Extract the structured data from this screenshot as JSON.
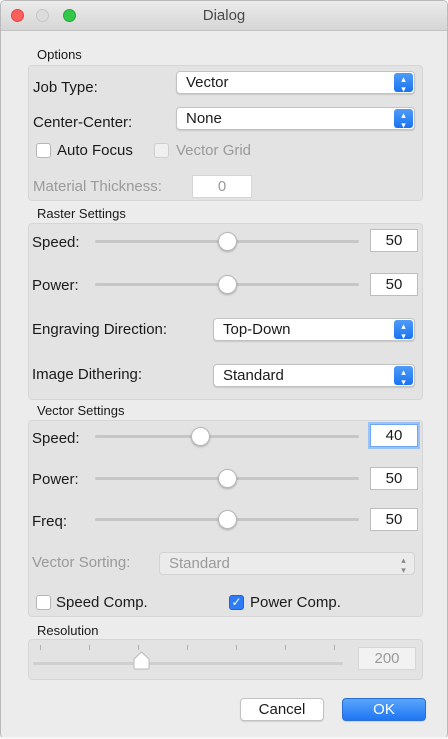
{
  "window": {
    "title": "Dialog"
  },
  "options": {
    "section_label": "Options",
    "job_type": {
      "label": "Job Type:",
      "value": "Vector"
    },
    "center_center": {
      "label": "Center-Center:",
      "value": "None"
    },
    "auto_focus": {
      "label": "Auto Focus",
      "checked": false
    },
    "vector_grid": {
      "label": "Vector Grid",
      "checked": false,
      "enabled": false
    },
    "material_thickness": {
      "label": "Material Thickness:",
      "value": "0",
      "enabled": false
    }
  },
  "raster": {
    "section_label": "Raster Settings",
    "speed": {
      "label": "Speed:",
      "value": "50",
      "slider_fraction": 0.5
    },
    "power": {
      "label": "Power:",
      "value": "50",
      "slider_fraction": 0.5
    },
    "engraving_direction": {
      "label": "Engraving Direction:",
      "value": "Top-Down"
    },
    "image_dithering": {
      "label": "Image Dithering:",
      "value": "Standard"
    }
  },
  "vector": {
    "section_label": "Vector Settings",
    "speed": {
      "label": "Speed:",
      "value": "40",
      "slider_fraction": 0.4
    },
    "power": {
      "label": "Power:",
      "value": "50",
      "slider_fraction": 0.5
    },
    "freq": {
      "label": "Freq:",
      "value": "50",
      "slider_fraction": 0.5
    },
    "vector_sorting": {
      "label": "Vector Sorting:",
      "value": "Standard",
      "enabled": false
    },
    "speed_comp": {
      "label": "Speed Comp.",
      "checked": false
    },
    "power_comp": {
      "label": "Power Comp.",
      "checked": true
    }
  },
  "resolution": {
    "section_label": "Resolution",
    "value": "200",
    "slider_fraction": 0.35,
    "enabled": false
  },
  "buttons": {
    "cancel": "Cancel",
    "ok": "OK"
  },
  "colors": {
    "accent": "#1f76f3",
    "close": "#fc605c",
    "maximize": "#34c84a"
  },
  "icons": {
    "dropdown": "chevron-updown-icon",
    "check": "check-icon"
  }
}
